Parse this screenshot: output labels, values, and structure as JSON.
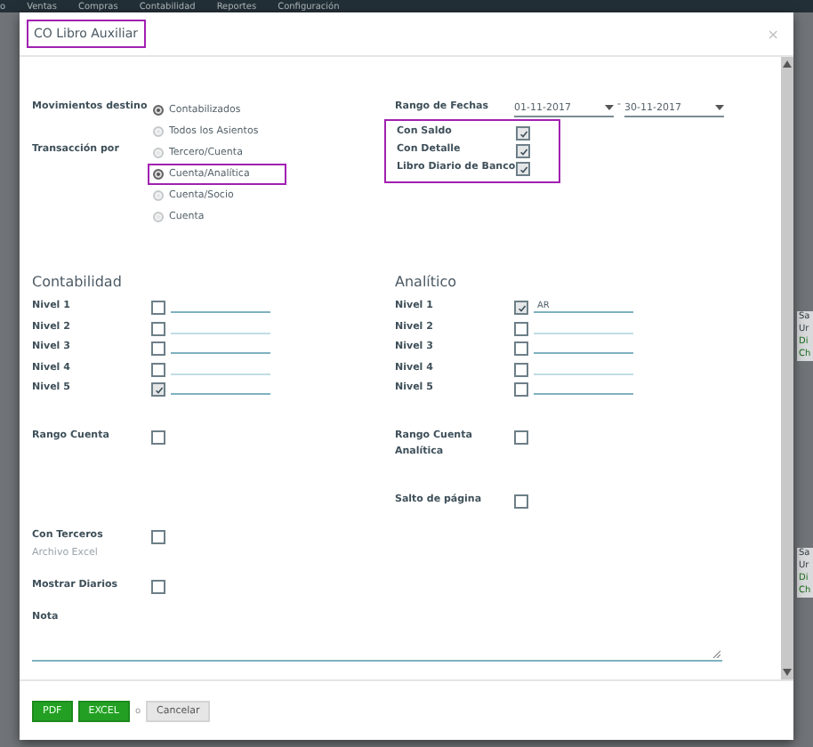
{
  "nav": [
    "o",
    "Ventas",
    "Compras",
    "Contabilidad",
    "Reportes",
    "Configuración"
  ],
  "background_fragments": [
    [
      "Sa",
      "Ur",
      "Di",
      "Ch"
    ],
    [
      "Sa",
      "Ur",
      "Di",
      "Ch"
    ]
  ],
  "dialog": {
    "title": "CO Libro Auxiliar",
    "title_highlighted": true,
    "close": "×"
  },
  "movimientos": {
    "label": "Movimientos destino",
    "options": [
      {
        "label": "Contabilizados",
        "selected": true,
        "highlighted": false
      },
      {
        "label": "Todos los Asientos",
        "selected": false,
        "highlighted": false
      }
    ]
  },
  "transaccion": {
    "label": "Transacción por",
    "options": [
      {
        "label": "Tercero/Cuenta",
        "selected": false,
        "highlighted": false
      },
      {
        "label": "Cuenta/Analítica",
        "selected": true,
        "highlighted": true
      },
      {
        "label": "Cuenta/Socio",
        "selected": false,
        "highlighted": false
      },
      {
        "label": "Cuenta",
        "selected": false,
        "highlighted": false
      }
    ]
  },
  "fechas": {
    "label": "Rango de Fechas",
    "from": "01-11-2017",
    "separator": "-",
    "to": "30-11-2017"
  },
  "flags_highlighted": true,
  "flags": [
    {
      "label": "Con Saldo",
      "checked": true
    },
    {
      "label": "Con Detalle",
      "checked": true
    },
    {
      "label": "Libro Diario de Banco",
      "checked": true
    }
  ],
  "contabilidad": {
    "title": "Contabilidad",
    "levels": [
      {
        "label": "Nivel 1",
        "checked": false
      },
      {
        "label": "Nivel 2",
        "checked": false
      },
      {
        "label": "Nivel 3",
        "checked": false
      },
      {
        "label": "Nivel 4",
        "checked": false
      },
      {
        "label": "Nivel 5",
        "checked": true
      }
    ]
  },
  "analitico": {
    "title": "Analítico",
    "levels": [
      {
        "label": "Nivel 1",
        "checked": true,
        "value": "AR"
      },
      {
        "label": "Nivel 2",
        "checked": false
      },
      {
        "label": "Nivel 3",
        "checked": false
      },
      {
        "label": "Nivel 4",
        "checked": false
      },
      {
        "label": "Nivel 5",
        "checked": false
      }
    ]
  },
  "rango_cuenta": {
    "label": "Rango Cuenta",
    "checked": false
  },
  "rango_cuenta_analitica": {
    "label": "Rango Cuenta Analítica",
    "checked": false
  },
  "salto_pagina": {
    "label": "Salto de página",
    "checked": false
  },
  "con_terceros": {
    "label": "Con Terceros",
    "checked": false
  },
  "archivo_excel": "Archivo Excel",
  "mostrar_diarios": {
    "label": "Mostrar Diarios",
    "checked": false
  },
  "nota": {
    "label": "Nota"
  },
  "buttons": [
    {
      "label": "PDF",
      "kind": "primary"
    },
    {
      "label": "EXCEL",
      "kind": "primary"
    },
    {
      "label": "o",
      "kind": "separator"
    },
    {
      "label": "Cancelar",
      "kind": "secondary"
    }
  ]
}
